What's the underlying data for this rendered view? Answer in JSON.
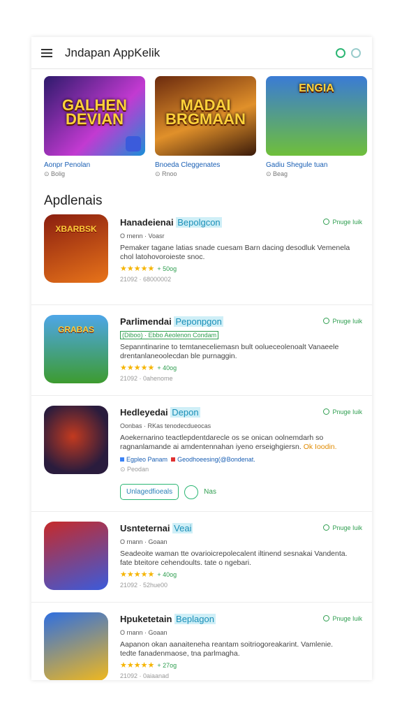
{
  "header": {
    "title": "Jndapan AppKelik"
  },
  "featured": [
    {
      "title": "GALHEN DEVIAN",
      "name": "Aonpr Penolan",
      "meta": "Bolig",
      "colors": [
        "#2d1a6b",
        "#c23ad1"
      ]
    },
    {
      "title": "MADAI BRGMAAN",
      "name": "Bnoeda Cleggenates",
      "meta": "Rnoo",
      "colors": [
        "#6b2a0e",
        "#e0902a"
      ]
    },
    {
      "title": "ENGIA",
      "name": "Gadiu Shegule tuan",
      "meta": "Beag",
      "colors": [
        "#3a7bd5",
        "#6fbf3a"
      ]
    }
  ],
  "section": {
    "title": "Apdlenais"
  },
  "apps": [
    {
      "title": "Hanadeienai",
      "highlight": "Bepolgcon",
      "action": "Pnuge Iuik",
      "sub": "O rnenn · Voasr",
      "desc": "Pemaker tagane latias snade cuesam Barn dacing desodluk Vemenela chol latohovoroieste snoc.",
      "stars": "★★★★★",
      "rating": "+ 50og",
      "foot": "21092 · 68000002",
      "icon_label": "XBARBSK",
      "colors": [
        "#8a1e0f",
        "#e8741a"
      ]
    },
    {
      "title": "Parlimendai",
      "highlight": "Peponpgon",
      "action": "Pnuge Iuik",
      "sub": "(Diboo) · Ebbo Aeolenon Condam",
      "desc": "Sepanntinarine to temtaneceliemasn bult oolueceolenoalt Vanaeele drentanlaneoolecdan ble purnaggin.",
      "stars": "★★★★★",
      "rating": "+ 40og",
      "foot": "21092 · 0ahenome",
      "icon_label": "GRABAS",
      "colors": [
        "#4ea6e8",
        "#3d9b2f"
      ]
    },
    {
      "title": "Hedleyedai",
      "highlight": "Depon",
      "action": "Pnuge Iuik",
      "sub": "Oonbas · RKas tenodecdueocas",
      "desc": "Aoekernarino teactlepdentdarecle os se onican oolnemdarh so ragnanlamande ai amdentennahan iyeno erseighgiersn.",
      "desc_extra": "Ok Ioodin.",
      "link1": "Egpleo Panam",
      "link2": "Geodhoeesing(@Bondenat.",
      "foot": "Peodan",
      "btn": "Unlagedfioeals",
      "btn_txt": "Nas",
      "icon_label": "",
      "colors": [
        "#2a1c3d",
        "#c33a1f"
      ]
    },
    {
      "title": "Usnteternai",
      "highlight": "Veai",
      "action": "Pnuge Iuik",
      "sub": "O rnann · Goaan",
      "desc": "Seadeoite waman tte ovarioicrepolecalent iltinend sesnakai Vandenta. fate bteitore cehendoults. tate o ngebari.",
      "stars": "★★★★★",
      "rating": "+ 40og",
      "foot": "21092 · 52hue00",
      "icon_label": "",
      "colors": [
        "#c62a2a",
        "#3b5bdb"
      ]
    },
    {
      "title": "Hpuketetain",
      "highlight": "Beplagon",
      "action": "Pnuge Iuik",
      "sub": "O rnann · Goaan",
      "desc": "Aapanon okan aanaiteneha reantam soitriogoreakarint. Vamlenie. tedte fanadenmaose, tna parlmagha.",
      "stars": "★★★★★",
      "rating": "+ 27og",
      "foot": "21092 · 0aiaanad",
      "icon_label": "",
      "colors": [
        "#2f6fe0",
        "#f0b81e"
      ]
    }
  ]
}
